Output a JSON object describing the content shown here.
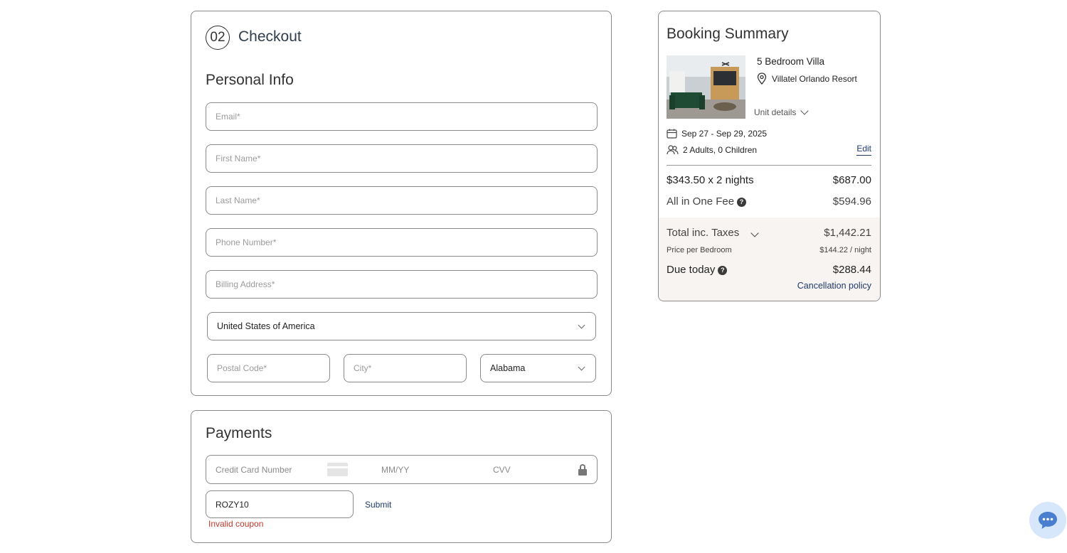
{
  "checkout": {
    "step_number": "02",
    "title": "Checkout",
    "personal_info_title": "Personal Info",
    "fields": {
      "email_placeholder": "Email*",
      "first_name_placeholder": "First Name*",
      "last_name_placeholder": "Last Name*",
      "phone_placeholder": "Phone Number*",
      "billing_address_placeholder": "Billing Address*",
      "country_value": "United States of America",
      "postal_code_placeholder": "Postal Code*",
      "city_placeholder": "City*",
      "state_value": "Alabama"
    }
  },
  "payments": {
    "title": "Payments",
    "card_number_placeholder": "Credit Card Number",
    "expiry_placeholder": "MM/YY",
    "cvv_placeholder": "CVV",
    "coupon_value": "ROZY10",
    "submit_label": "Submit",
    "error_text": "Invalid coupon"
  },
  "summary": {
    "title": "Booking Summary",
    "property_name": "5 Bedroom Villa",
    "location": "Villatel Orlando Resort",
    "unit_details_label": "Unit details",
    "dates": "Sep 27 - Sep 29, 2025",
    "guests": "2 Adults, 0 Children",
    "edit_label": "Edit",
    "nightly_label": "$343.50 x 2 nights",
    "nightly_amount": "$687.00",
    "fee_label": "All in One Fee",
    "fee_amount": "$594.96",
    "total_label": "Total inc. Taxes",
    "total_amount": "$1,442.21",
    "per_bedroom_label": "Price per Bedroom",
    "per_bedroom_amount": "$144.22 / night",
    "due_today_label": "Due today",
    "due_today_amount": "$288.44",
    "cancellation_label": "Cancellation policy"
  },
  "icons": {
    "card": "credit-card-icon",
    "lock": "lock-icon",
    "location": "location-pin-icon",
    "calendar": "calendar-icon",
    "guests": "users-icon",
    "help": "help-icon",
    "chat": "chat-icon"
  },
  "colors": {
    "link": "#1d3a6b",
    "error": "#c0392b",
    "totals_bg": "#f7f4f2",
    "chat_bg": "#d6e6fb",
    "chat_icon": "#4a7fd0"
  }
}
